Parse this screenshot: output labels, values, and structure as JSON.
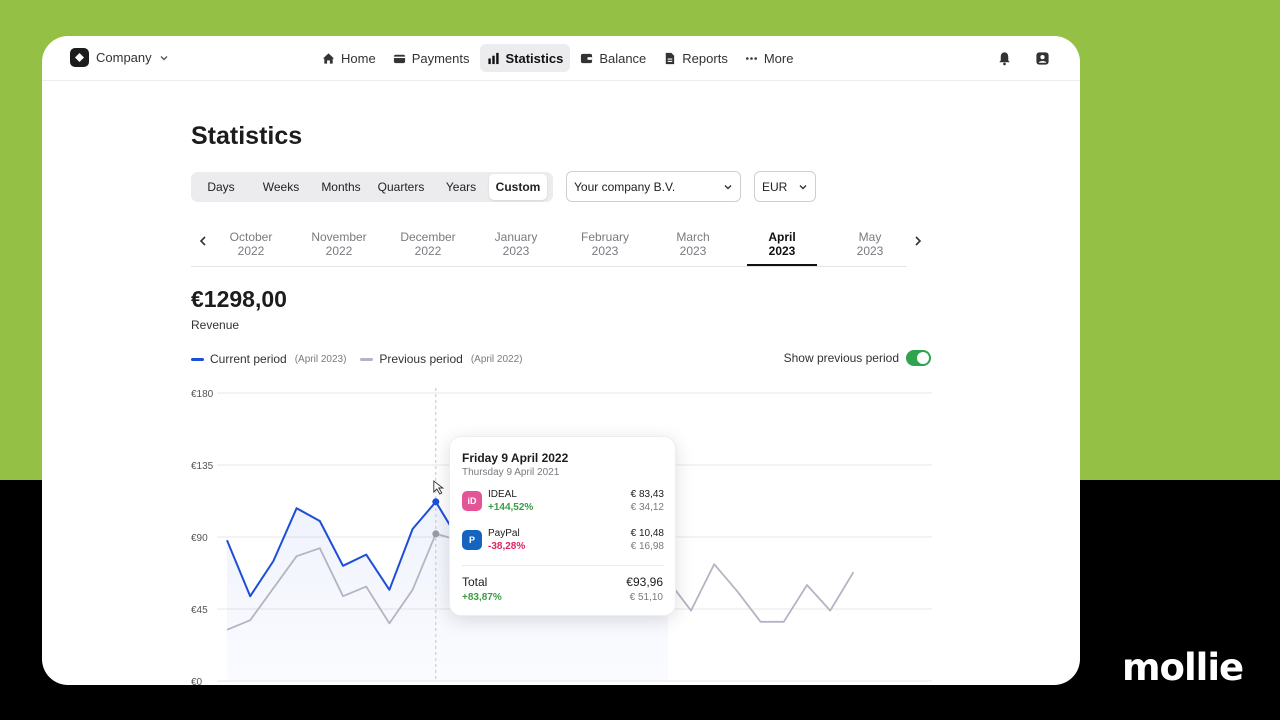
{
  "colors": {
    "background_top": "#94c045",
    "background_bottom": "#000000",
    "current_series": "#1d4ed8",
    "previous_series": "#b4b4c4",
    "toggle_on": "#2ea44f",
    "positive": "#3a9d44",
    "negative": "#e0245e"
  },
  "brand": {
    "name": "mollie"
  },
  "topnav": {
    "company": "Company",
    "links": [
      {
        "label": "Home",
        "icon": "home-icon",
        "active": false
      },
      {
        "label": "Payments",
        "icon": "payments-icon",
        "active": false
      },
      {
        "label": "Statistics",
        "icon": "bar-chart-icon",
        "active": true
      },
      {
        "label": "Balance",
        "icon": "wallet-icon",
        "active": false
      },
      {
        "label": "Reports",
        "icon": "document-icon",
        "active": false
      },
      {
        "label": "More",
        "icon": "more-dots-icon",
        "active": false
      }
    ]
  },
  "page": {
    "title": "Statistics",
    "range_tabs": [
      "Days",
      "Weeks",
      "Months",
      "Quarters",
      "Years",
      "Custom"
    ],
    "active_range": "Custom",
    "company_select": "Your company B.V.",
    "currency_select": "EUR",
    "months": [
      {
        "month": "October",
        "year": "2022"
      },
      {
        "month": "November",
        "year": "2022"
      },
      {
        "month": "December",
        "year": "2022"
      },
      {
        "month": "January",
        "year": "2023"
      },
      {
        "month": "February",
        "year": "2023"
      },
      {
        "month": "March",
        "year": "2023"
      },
      {
        "month": "April",
        "year": "2023"
      },
      {
        "month": "May",
        "year": "2023"
      }
    ],
    "active_month_index": 6,
    "revenue_value": "€1298,00",
    "revenue_label": "Revenue",
    "legend": {
      "current_label": "Current period",
      "current_period": "(April 2023)",
      "previous_label": "Previous period",
      "previous_period": "(April 2022)"
    },
    "show_previous_label": "Show previous period",
    "show_previous_on": true
  },
  "chart_data": {
    "type": "line",
    "y_ticks": [
      "€180",
      "€135",
      "€90",
      "€45",
      "€0"
    ],
    "ylim": [
      0,
      180
    ],
    "grid": true,
    "series": [
      {
        "name": "Current period",
        "values": [
          88,
          53,
          75,
          108,
          100,
          72,
          79,
          57,
          95,
          112,
          88,
          103,
          100,
          108,
          96,
          77,
          94,
          88,
          91,
          76
        ]
      },
      {
        "name": "Previous period",
        "values": [
          32,
          38,
          58,
          78,
          83,
          53,
          59,
          36,
          57,
          92,
          88,
          82,
          90,
          110,
          85,
          103,
          91,
          84,
          58,
          63,
          44,
          73,
          56,
          37,
          37,
          60,
          44,
          68
        ]
      }
    ],
    "highlight_index": 9
  },
  "tooltip": {
    "title": "Friday 9 April 2022",
    "subtitle": "Thursday 9 April 2021",
    "rows": [
      {
        "name": "IDEAL",
        "change": "+144,52%",
        "value": "€ 83,43",
        "previous": "€ 34,12",
        "icon": "ideal-icon",
        "icon_color": "#e25597",
        "trend": "up"
      },
      {
        "name": "PayPal",
        "change": "-38,28%",
        "value": "€ 10,48",
        "previous": "€ 16,98",
        "icon": "paypal-icon",
        "icon_color": "#1565c0",
        "trend": "down"
      }
    ],
    "total_label": "Total",
    "total_change": "+83,87%",
    "total_value": "€93,96",
    "total_previous": "€ 51,10"
  }
}
